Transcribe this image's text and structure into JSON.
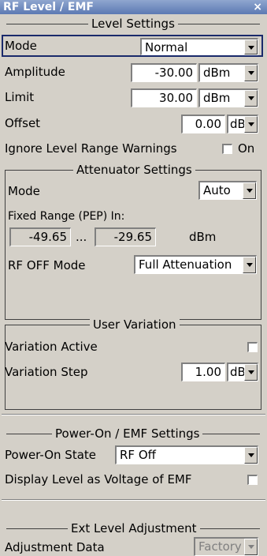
{
  "window": {
    "title": "RF Level / EMF",
    "close": "×"
  },
  "level_settings": {
    "legend": "Level Settings",
    "mode_label": "Mode",
    "mode_value": "Normal",
    "amplitude_label": "Amplitude",
    "amplitude_value": "-30.00",
    "amplitude_unit": "dBm",
    "limit_label": "Limit",
    "limit_value": "30.00",
    "limit_unit": "dBm",
    "offset_label": "Offset",
    "offset_value": "0.00",
    "offset_unit": "dB",
    "ignore_label": "Ignore Level Range Warnings",
    "ignore_on": "On",
    "ignore_checked": false
  },
  "attenuator_settings": {
    "legend": "Attenuator Settings",
    "mode_label": "Mode",
    "mode_value": "Auto",
    "fixed_range_label": "Fixed Range (PEP) In:",
    "range_min": "-49.65",
    "range_sep": "...",
    "range_max": "-29.65",
    "range_unit": "dBm",
    "rf_off_label": "RF OFF Mode",
    "rf_off_value": "Full Attenuation"
  },
  "user_variation": {
    "legend": "User Variation",
    "active_label": "Variation Active",
    "active_checked": false,
    "step_label": "Variation Step",
    "step_value": "1.00",
    "step_unit": "dB"
  },
  "power_on": {
    "legend": "Power-On / EMF Settings",
    "state_label": "Power-On State",
    "state_value": "RF Off",
    "display_label": "Display Level as Voltage of EMF",
    "display_checked": false
  },
  "ext_level": {
    "legend": "Ext Level Adjustment",
    "adjust_label": "Adjustment Data",
    "adjust_value": "Factory"
  }
}
